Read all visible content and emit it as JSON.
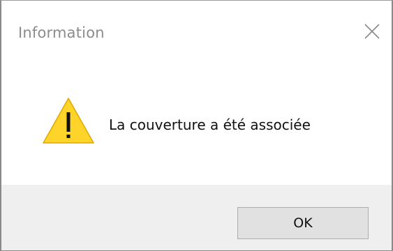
{
  "dialog": {
    "title": "Information",
    "message": "La couverture a été associée",
    "ok_label": "OK",
    "icons": {
      "close": "close-icon",
      "warning": "warning-icon"
    },
    "colors": {
      "warning_fill": "#FFD42A",
      "footer_bg": "#EFEFEF",
      "button_bg": "#E1E1E1"
    }
  }
}
